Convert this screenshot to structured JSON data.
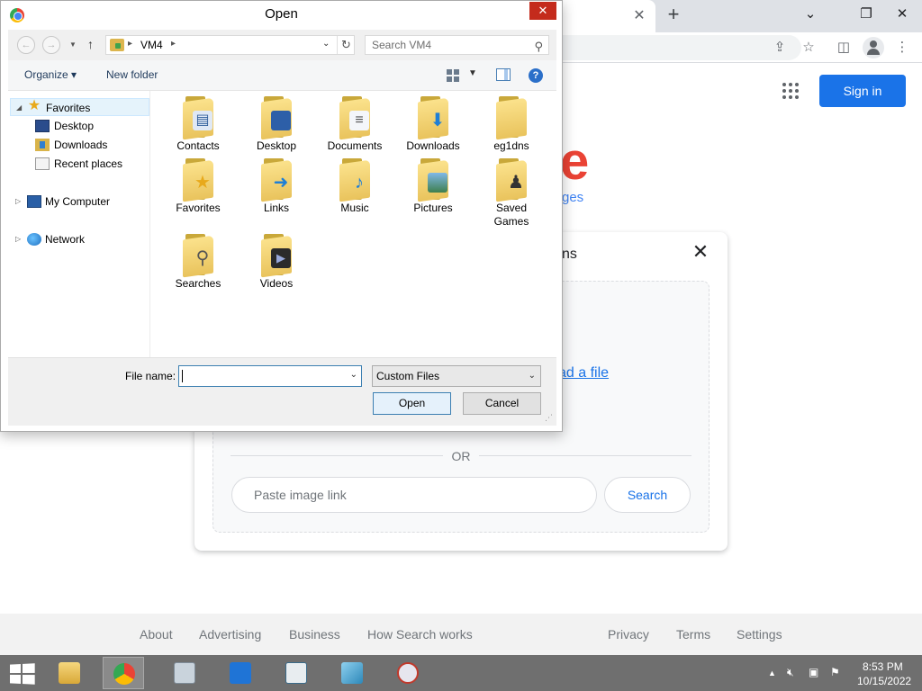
{
  "browser": {
    "tab_close": "✕",
    "new_tab": "+",
    "win_minimize": "⌄",
    "win_restore": "❐",
    "win_close": "✕",
    "icons": [
      "share-icon",
      "star-icon",
      "sidebar-icon",
      "profile-icon",
      "more-icon"
    ],
    "sign_in": "Sign in",
    "logo_fragment": "e",
    "logo_sub_fragment": "ges",
    "accent": "#1a73e8"
  },
  "lens": {
    "title_fragment": "ns",
    "close": "✕",
    "upload_fragment": "ad a file",
    "or": "OR",
    "paste_placeholder": "Paste image link",
    "search_button": "Search"
  },
  "footer": {
    "links": [
      "About",
      "Advertising",
      "Business",
      "How Search works",
      "Privacy",
      "Terms",
      "Settings"
    ]
  },
  "dialog": {
    "title": "Open",
    "close": "✕",
    "address": {
      "location": "VM4",
      "search_placeholder": "Search VM4"
    },
    "commands": {
      "organize": "Organize",
      "new_folder": "New folder"
    },
    "nav_tree": [
      {
        "label": "Favorites",
        "icon": "star-icon",
        "selected": true
      },
      {
        "label": "Desktop",
        "icon": "desktop-icon"
      },
      {
        "label": "Downloads",
        "icon": "downloads-icon"
      },
      {
        "label": "Recent places",
        "icon": "recent-places-icon"
      },
      {
        "label": "My Computer",
        "icon": "computer-icon"
      },
      {
        "label": "Network",
        "icon": "network-icon"
      }
    ],
    "folders": [
      {
        "label": "Contacts",
        "icon": "contacts-folder-icon"
      },
      {
        "label": "Desktop",
        "icon": "desktop-folder-icon"
      },
      {
        "label": "Documents",
        "icon": "documents-folder-icon"
      },
      {
        "label": "Downloads",
        "icon": "downloads-folder-icon"
      },
      {
        "label": "eg1dns",
        "icon": "folder-icon"
      },
      {
        "label": "Favorites",
        "icon": "favorites-folder-icon"
      },
      {
        "label": "Links",
        "icon": "links-folder-icon"
      },
      {
        "label": "Music",
        "icon": "music-folder-icon"
      },
      {
        "label": "Pictures",
        "icon": "pictures-folder-icon"
      },
      {
        "label": "Saved Games",
        "icon": "saved-games-folder-icon"
      },
      {
        "label": "Searches",
        "icon": "searches-folder-icon"
      },
      {
        "label": "Videos",
        "icon": "videos-folder-icon"
      }
    ],
    "file_name_label": "File name:",
    "file_name_value": "",
    "file_type": "Custom Files",
    "open_button": "Open",
    "cancel_button": "Cancel"
  },
  "taskbar": {
    "apps": [
      "file-explorer-icon",
      "chrome-icon",
      "task-manager-icon",
      "remote-desktop-icon",
      "notepad-icon",
      "paint-icon",
      "snipping-tool-icon"
    ],
    "tray_up": "▲",
    "time": "8:53 PM",
    "date": "10/15/2022"
  }
}
